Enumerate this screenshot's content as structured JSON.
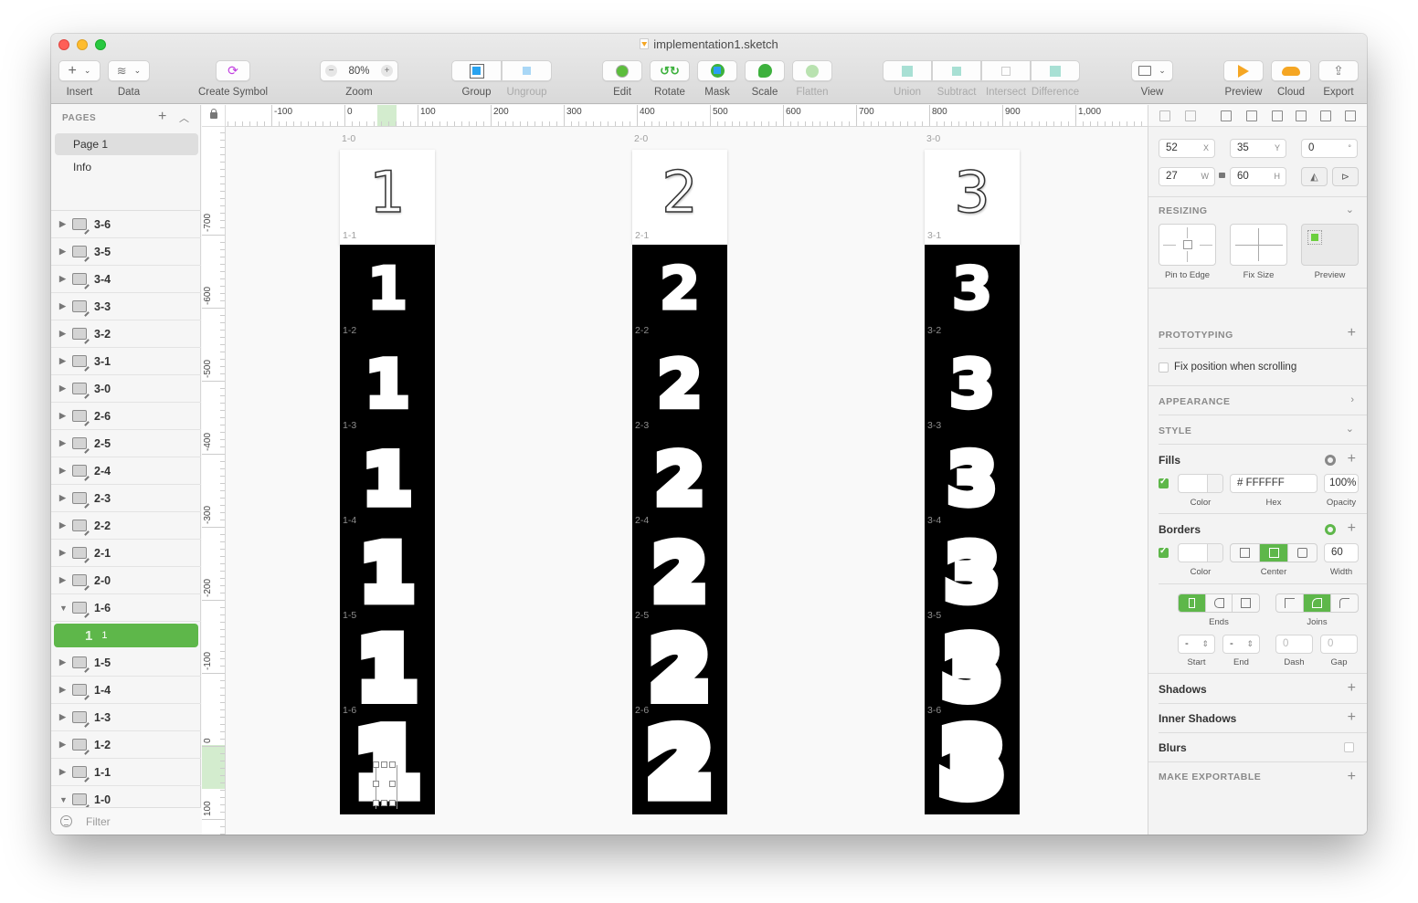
{
  "window": {
    "title": "implementation1.sketch"
  },
  "toolbar": {
    "insert": "Insert",
    "data": "Data",
    "create_symbol": "Create Symbol",
    "zoom_label": "Zoom",
    "zoom_value": "80%",
    "zoom_minus": "−",
    "zoom_plus": "+",
    "group": "Group",
    "ungroup": "Ungroup",
    "edit": "Edit",
    "rotate": "Rotate",
    "mask": "Mask",
    "scale": "Scale",
    "flatten": "Flatten",
    "union": "Union",
    "subtract": "Subtract",
    "intersect": "Intersect",
    "difference": "Difference",
    "view": "View",
    "preview": "Preview",
    "cloud": "Cloud",
    "export": "Export"
  },
  "sidebar": {
    "pages_header": "PAGES",
    "pages": [
      {
        "label": "Page 1",
        "active": true
      },
      {
        "label": "Info",
        "active": false
      }
    ],
    "layers": [
      {
        "label": "3-6",
        "expanded": false
      },
      {
        "label": "3-5",
        "expanded": false
      },
      {
        "label": "3-4",
        "expanded": false
      },
      {
        "label": "3-3",
        "expanded": false
      },
      {
        "label": "3-2",
        "expanded": false
      },
      {
        "label": "3-1",
        "expanded": false
      },
      {
        "label": "3-0",
        "expanded": false
      },
      {
        "label": "2-6",
        "expanded": false
      },
      {
        "label": "2-5",
        "expanded": false
      },
      {
        "label": "2-4",
        "expanded": false
      },
      {
        "label": "2-3",
        "expanded": false
      },
      {
        "label": "2-2",
        "expanded": false
      },
      {
        "label": "2-1",
        "expanded": false
      },
      {
        "label": "2-0",
        "expanded": false
      },
      {
        "label": "1-6",
        "expanded": true
      },
      {
        "label": "1-5",
        "expanded": false
      },
      {
        "label": "1-4",
        "expanded": false
      },
      {
        "label": "1-3",
        "expanded": false
      },
      {
        "label": "1-2",
        "expanded": false
      },
      {
        "label": "1-1",
        "expanded": false
      },
      {
        "label": "1-0",
        "expanded": true
      }
    ],
    "selected_layer": {
      "glyph": "1",
      "label": "1"
    },
    "filter_placeholder": "Filter"
  },
  "rulers": {
    "horizontal": [
      "-100",
      "0",
      "100",
      "200",
      "300",
      "400",
      "500",
      "600",
      "700",
      "800",
      "900",
      "1,000"
    ],
    "vertical": [
      "-700",
      "-600",
      "-500",
      "-400",
      "-300",
      "-200",
      "-100",
      "0",
      "100"
    ]
  },
  "canvas": {
    "columns": [
      {
        "digit": "1",
        "artboards": [
          "1-0",
          "1-1",
          "1-2",
          "1-3",
          "1-4",
          "1-5",
          "1-6"
        ]
      },
      {
        "digit": "2",
        "artboards": [
          "2-0",
          "2-1",
          "2-2",
          "2-3",
          "2-4",
          "2-5",
          "2-6"
        ]
      },
      {
        "digit": "3",
        "artboards": [
          "3-0",
          "3-1",
          "3-2",
          "3-3",
          "3-4",
          "3-5",
          "3-6"
        ]
      }
    ]
  },
  "inspector": {
    "x": "52",
    "x_label": "X",
    "y": "35",
    "y_label": "Y",
    "rotation": "0",
    "rotation_unit": "°",
    "w": "27",
    "w_label": "W",
    "h": "60",
    "h_label": "H",
    "resizing": "RESIZING",
    "pin_to_edge": "Pin to Edge",
    "fix_size": "Fix Size",
    "preview": "Preview",
    "prototyping": "PROTOTYPING",
    "fix_position": "Fix position when scrolling",
    "appearance": "APPEARANCE",
    "style": "STYLE",
    "fills": "Fills",
    "fill_hex": "# FFFFFF",
    "fill_opacity": "100%",
    "color_label": "Color",
    "hex_label": "Hex",
    "opacity_label": "Opacity",
    "borders": "Borders",
    "border_width": "60",
    "border_position": "Center",
    "width_label": "Width",
    "ends": "Ends",
    "joins": "Joins",
    "start_value": "-",
    "end_value": "-",
    "dash_value": "0",
    "gap_value": "0",
    "start_label": "Start",
    "end_label": "End",
    "dash_label": "Dash",
    "gap_label": "Gap",
    "shadows": "Shadows",
    "inner_shadows": "Inner Shadows",
    "blurs": "Blurs",
    "make_exportable": "MAKE EXPORTABLE",
    "accent_color": "#5EB74A"
  }
}
